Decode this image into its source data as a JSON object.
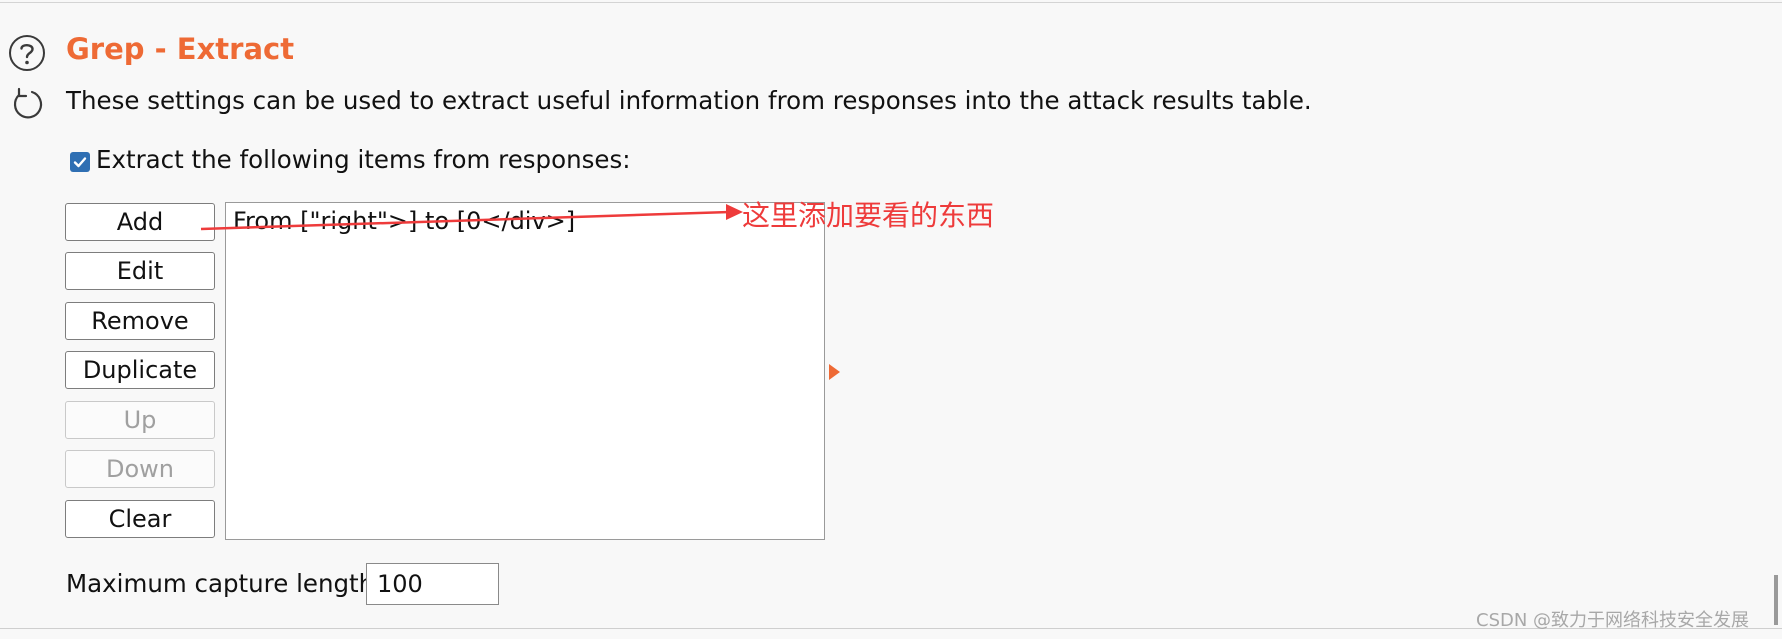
{
  "section": {
    "title": "Grep - Extract",
    "description": "These settings can be used to extract useful information from responses into the attack results table."
  },
  "extract": {
    "checkbox_label": "Extract the following items from responses:",
    "checked": true,
    "buttons": {
      "add": "Add",
      "edit": "Edit",
      "remove": "Remove",
      "duplicate": "Duplicate",
      "up": "Up",
      "down": "Down",
      "clear": "Clear"
    },
    "items": [
      "From [\"right\">] to [0</div>]"
    ]
  },
  "max_capture": {
    "label": "Maximum capture length:",
    "value": "100"
  },
  "annotation": {
    "text": "这里添加要看的东西",
    "color": "#ee3b3b"
  },
  "watermark": "CSDN @致力于网络科技安全发展",
  "colors": {
    "accent": "#ee6a35",
    "checkbox": "#2f6fb3"
  },
  "icons": {
    "help": "help-circle-icon",
    "refresh": "refresh-icon",
    "expand": "triangle-right-icon"
  }
}
